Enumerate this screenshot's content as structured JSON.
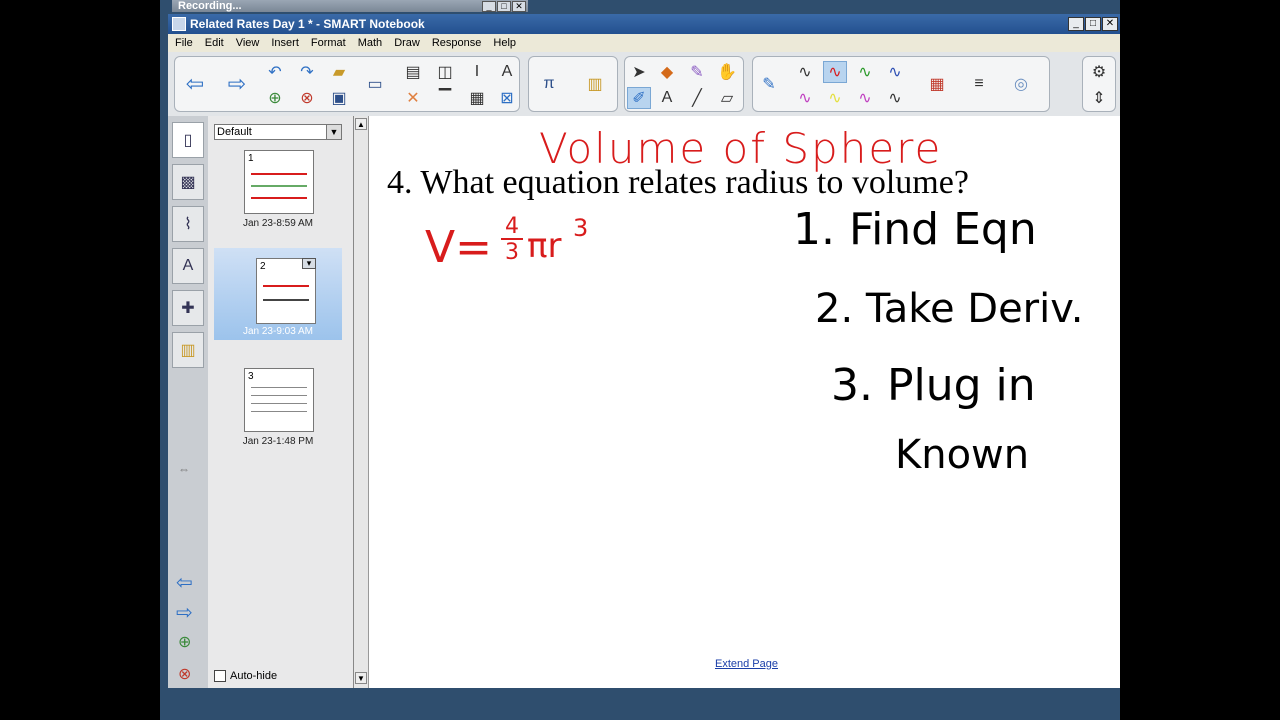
{
  "recording": {
    "label": "Recording..."
  },
  "window": {
    "title": "Related Rates Day 1 * - SMART Notebook"
  },
  "menu": [
    "File",
    "Edit",
    "View",
    "Insert",
    "Format",
    "Math",
    "Draw",
    "Response",
    "Help"
  ],
  "sorter": {
    "dropdown_value": "Default",
    "pages": [
      {
        "number": "1",
        "label": "Jan 23-8:59 AM"
      },
      {
        "number": "2",
        "label": "Jan 23-9:03 AM"
      },
      {
        "number": "3",
        "label": "Jan 23-1:48 PM"
      }
    ],
    "auto_hide_label": "Auto-hide"
  },
  "canvas": {
    "ink_title": "Volume of Sphere",
    "question": "4.  What equation relates radius to volume?",
    "formula_main": "V=",
    "formula_num": "4",
    "formula_den": "3",
    "formula_rest": "πr",
    "formula_exp": "3",
    "steps": [
      "1.  Find Eqn",
      "2. Take Deriv.",
      "3. Plug in",
      "Known"
    ],
    "extend_link": "Extend Page"
  },
  "colors": {
    "ink_red": "#d81c1c",
    "title_bar": "#23508f"
  }
}
